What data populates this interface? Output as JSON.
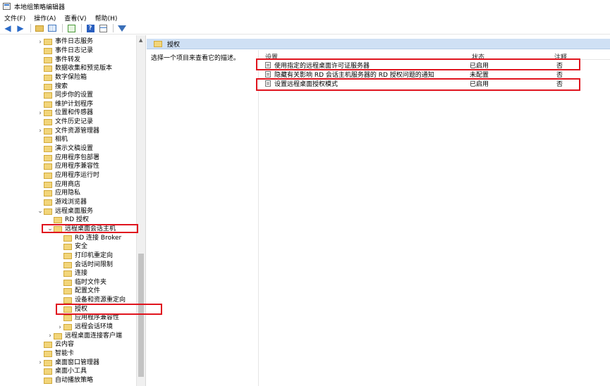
{
  "window": {
    "title": "本地组策略编辑器"
  },
  "menu": [
    "文件(F)",
    "操作(A)",
    "查看(V)",
    "帮助(H)"
  ],
  "toolbar": {
    "buttons": [
      "back-icon",
      "forward-icon",
      "up-folder-icon",
      "show-hide-tree-icon",
      "export-list-icon",
      "help-icon",
      "properties-icon",
      "filter-icon"
    ],
    "help_glyph": "?"
  },
  "tree": [
    {
      "label": "事件日志服务",
      "arrow": ">"
    },
    {
      "label": "事件日志记录",
      "arrow": ""
    },
    {
      "label": "事件转发",
      "arrow": ""
    },
    {
      "label": "数据收集和预览版本",
      "arrow": ""
    },
    {
      "label": "数字保险箱",
      "arrow": ""
    },
    {
      "label": "搜索",
      "arrow": ""
    },
    {
      "label": "同步你的设置",
      "arrow": ""
    },
    {
      "label": "维护计划程序",
      "arrow": ""
    },
    {
      "label": "位置和传感器",
      "arrow": ">"
    },
    {
      "label": "文件历史记录",
      "arrow": ""
    },
    {
      "label": "文件资源管理器",
      "arrow": ">"
    },
    {
      "label": "相机",
      "arrow": ""
    },
    {
      "label": "演示文稿设置",
      "arrow": ""
    },
    {
      "label": "应用程序包部署",
      "arrow": ""
    },
    {
      "label": "应用程序兼容性",
      "arrow": ""
    },
    {
      "label": "应用程序运行时",
      "arrow": ""
    },
    {
      "label": "应用商店",
      "arrow": ""
    },
    {
      "label": "应用隐私",
      "arrow": ""
    },
    {
      "label": "游戏浏览器",
      "arrow": ""
    },
    {
      "label": "远程桌面服务",
      "arrow": "v"
    },
    {
      "label": "RD 授权",
      "arrow": ""
    },
    {
      "label": "远程桌面会话主机",
      "arrow": "v"
    },
    {
      "label": "RD 连接 Broker",
      "arrow": ""
    },
    {
      "label": "安全",
      "arrow": ""
    },
    {
      "label": "打印机重定向",
      "arrow": ""
    },
    {
      "label": "会话时间限制",
      "arrow": ""
    },
    {
      "label": "连接",
      "arrow": ""
    },
    {
      "label": "临时文件夹",
      "arrow": ""
    },
    {
      "label": "配置文件",
      "arrow": ""
    },
    {
      "label": "设备和资源重定向",
      "arrow": ""
    },
    {
      "label": "授权",
      "arrow": ""
    },
    {
      "label": "应用程序兼容性",
      "arrow": ""
    },
    {
      "label": "远程会话环境",
      "arrow": ">"
    },
    {
      "label": "远程桌面连接客户端",
      "arrow": ">"
    },
    {
      "label": "云内容",
      "arrow": ""
    },
    {
      "label": "智能卡",
      "arrow": ""
    },
    {
      "label": "桌面窗口管理器",
      "arrow": ">"
    },
    {
      "label": "桌面小工具",
      "arrow": ""
    },
    {
      "label": "自动播放策略",
      "arrow": ""
    }
  ],
  "right": {
    "header_title": "授权",
    "description": "选择一个项目来查看它的描述。",
    "columns": {
      "setting": "设置",
      "state": "状态",
      "comment": "注释"
    },
    "policies": [
      {
        "name": "使用指定的远程桌面许可证服务器",
        "state": "已启用",
        "comment": "否"
      },
      {
        "name": "隐藏有关影响 RD 会话主机服务器的 RD 授权问题的通知",
        "state": "未配置",
        "comment": "否"
      },
      {
        "name": "设置远程桌面授权模式",
        "state": "已启用",
        "comment": "否"
      }
    ]
  },
  "colors": {
    "highlight_box": "#e0141e",
    "header_strip": "#cfe0f4",
    "folder": "#f2d57a"
  }
}
